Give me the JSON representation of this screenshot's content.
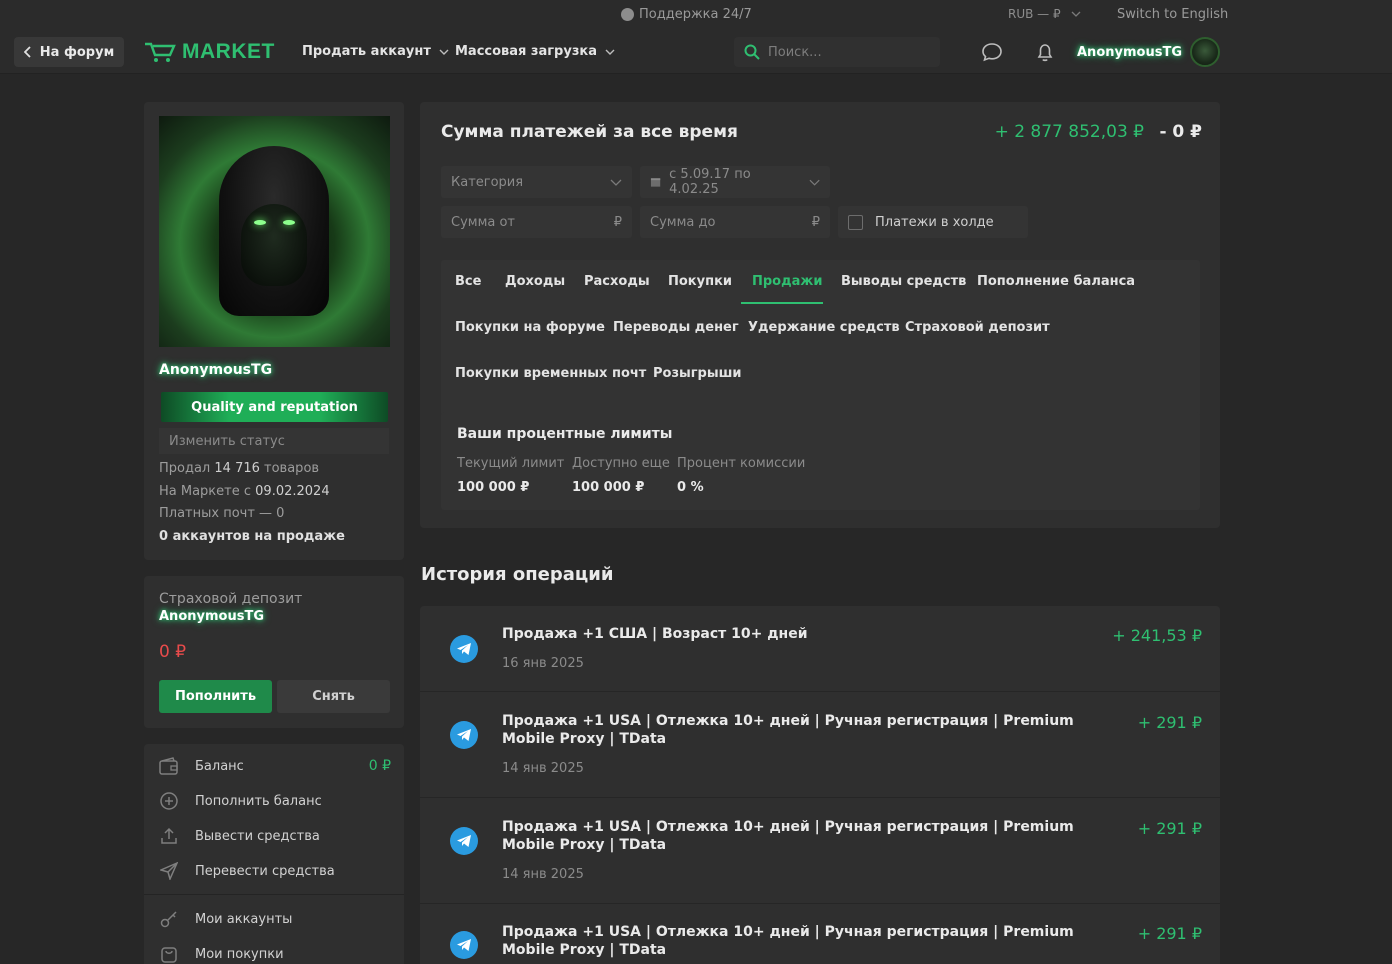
{
  "topbar": {
    "support": "Поддержка 24/7",
    "currency": "RUB — ₽",
    "language": "Switch to English"
  },
  "navbar": {
    "back_label": "На форум",
    "logo_text": "MARKET",
    "sell_label": "Продать аккаунт",
    "bulk_label": "Массовая загрузка",
    "search_placeholder": "Поиск...",
    "username": "AnonymousTG"
  },
  "profile": {
    "name": "AnonymousTG",
    "badge": "Quality and reputation",
    "status_placeholder": "Изменить статус",
    "sold_prefix": "Продал",
    "sold_count": "14 716",
    "sold_suffix": "товаров",
    "since_prefix": "На Маркете с",
    "since_date": "09.02.2024",
    "paid_mail": "Платных почт — 0",
    "on_sale": "0 аккаунтов на продаже"
  },
  "deposit": {
    "title": "Страховой депозит",
    "name": "AnonymousTG",
    "amount": "0 ₽",
    "topup_label": "Пополнить",
    "withdraw_label": "Снять"
  },
  "menu": {
    "items": [
      {
        "label": "Баланс",
        "value": "0 ₽",
        "icon": "wallet-icon"
      },
      {
        "label": "Пополнить баланс",
        "value": "",
        "icon": "plus-circle-icon"
      },
      {
        "label": "Вывести средства",
        "value": "",
        "icon": "upload-icon"
      },
      {
        "label": "Перевести средства",
        "value": "",
        "icon": "send-icon"
      },
      {
        "label": "Мои аккаунты",
        "value": "",
        "icon": "key-icon"
      },
      {
        "label": "Мои покупки",
        "value": "",
        "icon": "bag-icon"
      }
    ]
  },
  "payments": {
    "title": "Сумма платежей за все время",
    "total_plus": "+ 2 877 852,03 ₽",
    "total_minus": "- 0 ₽",
    "category_label": "Категория",
    "date_range": "с 5.09.17 по 4.02.25",
    "sum_from_placeholder": "Сумма от",
    "sum_to_placeholder": "Сумма до",
    "currency_symbol": "₽",
    "hold_label": "Платежи в холде",
    "tabs": [
      "Все",
      "Доходы",
      "Расходы",
      "Покупки",
      "Продажи",
      "Выводы средств",
      "Пополнение баланса",
      "Покупки на форуме",
      "Переводы денег",
      "Удержание средств",
      "Страховой депозит",
      "Покупки временных почт",
      "Розыгрыши"
    ],
    "active_tab": "Продажи"
  },
  "limits": {
    "title": "Ваши процентные лимиты",
    "current_label": "Текущий лимит",
    "current_value": "100 000 ₽",
    "available_label": "Доступно еще",
    "available_value": "100 000 ₽",
    "commission_label": "Процент комиссии",
    "commission_value": "0 %"
  },
  "history": {
    "title": "История операций",
    "operations": [
      {
        "title": "Продажа +1 США | Возраст 10+ дней",
        "date": "16 янв 2025",
        "amount": "+ 241,53 ₽"
      },
      {
        "title": "Продажа +1 USA | Отлежка 10+ дней | Ручная регистрация | Premium Mobile Proxy | TData",
        "date": "14 янв 2025",
        "amount": "+ 291 ₽"
      },
      {
        "title": "Продажа +1 USA | Отлежка 10+ дней | Ручная регистрация | Premium Mobile Proxy | TData",
        "date": "14 янв 2025",
        "amount": "+ 291 ₽"
      },
      {
        "title": "Продажа +1 USA | Отлежка 10+ дней | Ручная регистрация | Premium Mobile Proxy | TData",
        "date": "",
        "amount": "+ 291 ₽"
      }
    ]
  },
  "colors": {
    "accent_green": "#2fbf71",
    "negative_red": "#e84b4b",
    "background": "#272727",
    "card": "#2f2f2f"
  }
}
